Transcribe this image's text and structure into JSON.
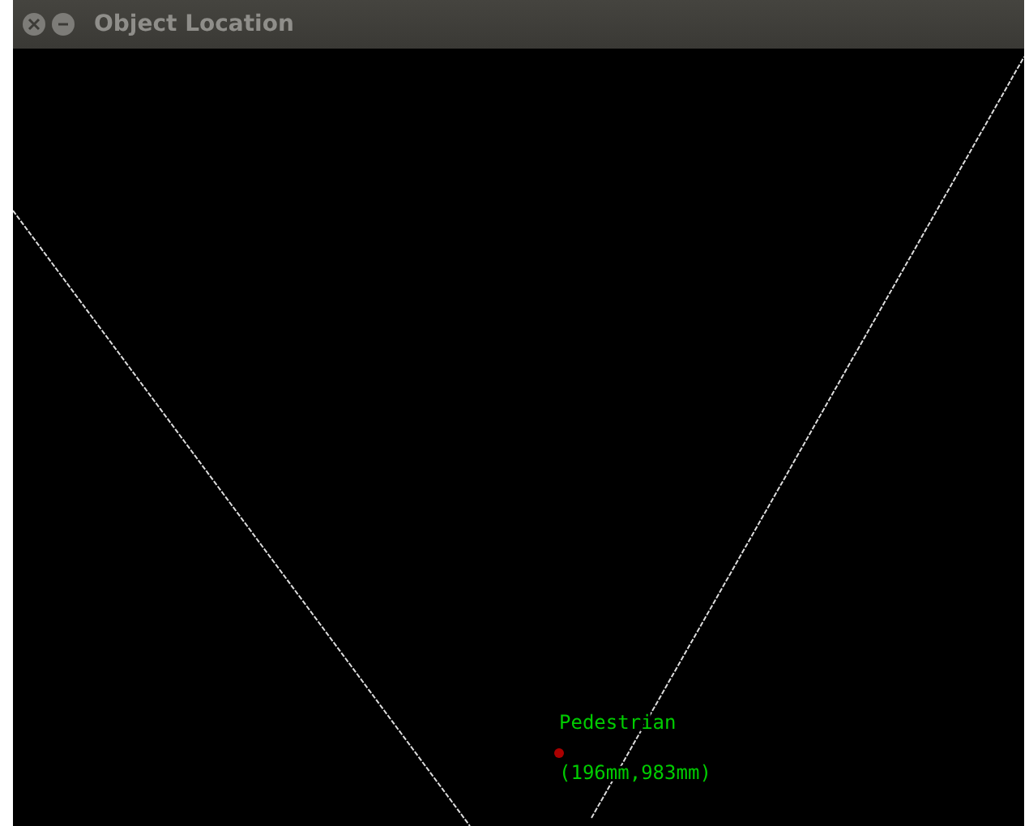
{
  "window": {
    "title": "Object Location"
  },
  "objects": [
    {
      "label": "Pedestrian",
      "position": "(196mm,983mm)",
      "color": "#aa0000"
    }
  ]
}
